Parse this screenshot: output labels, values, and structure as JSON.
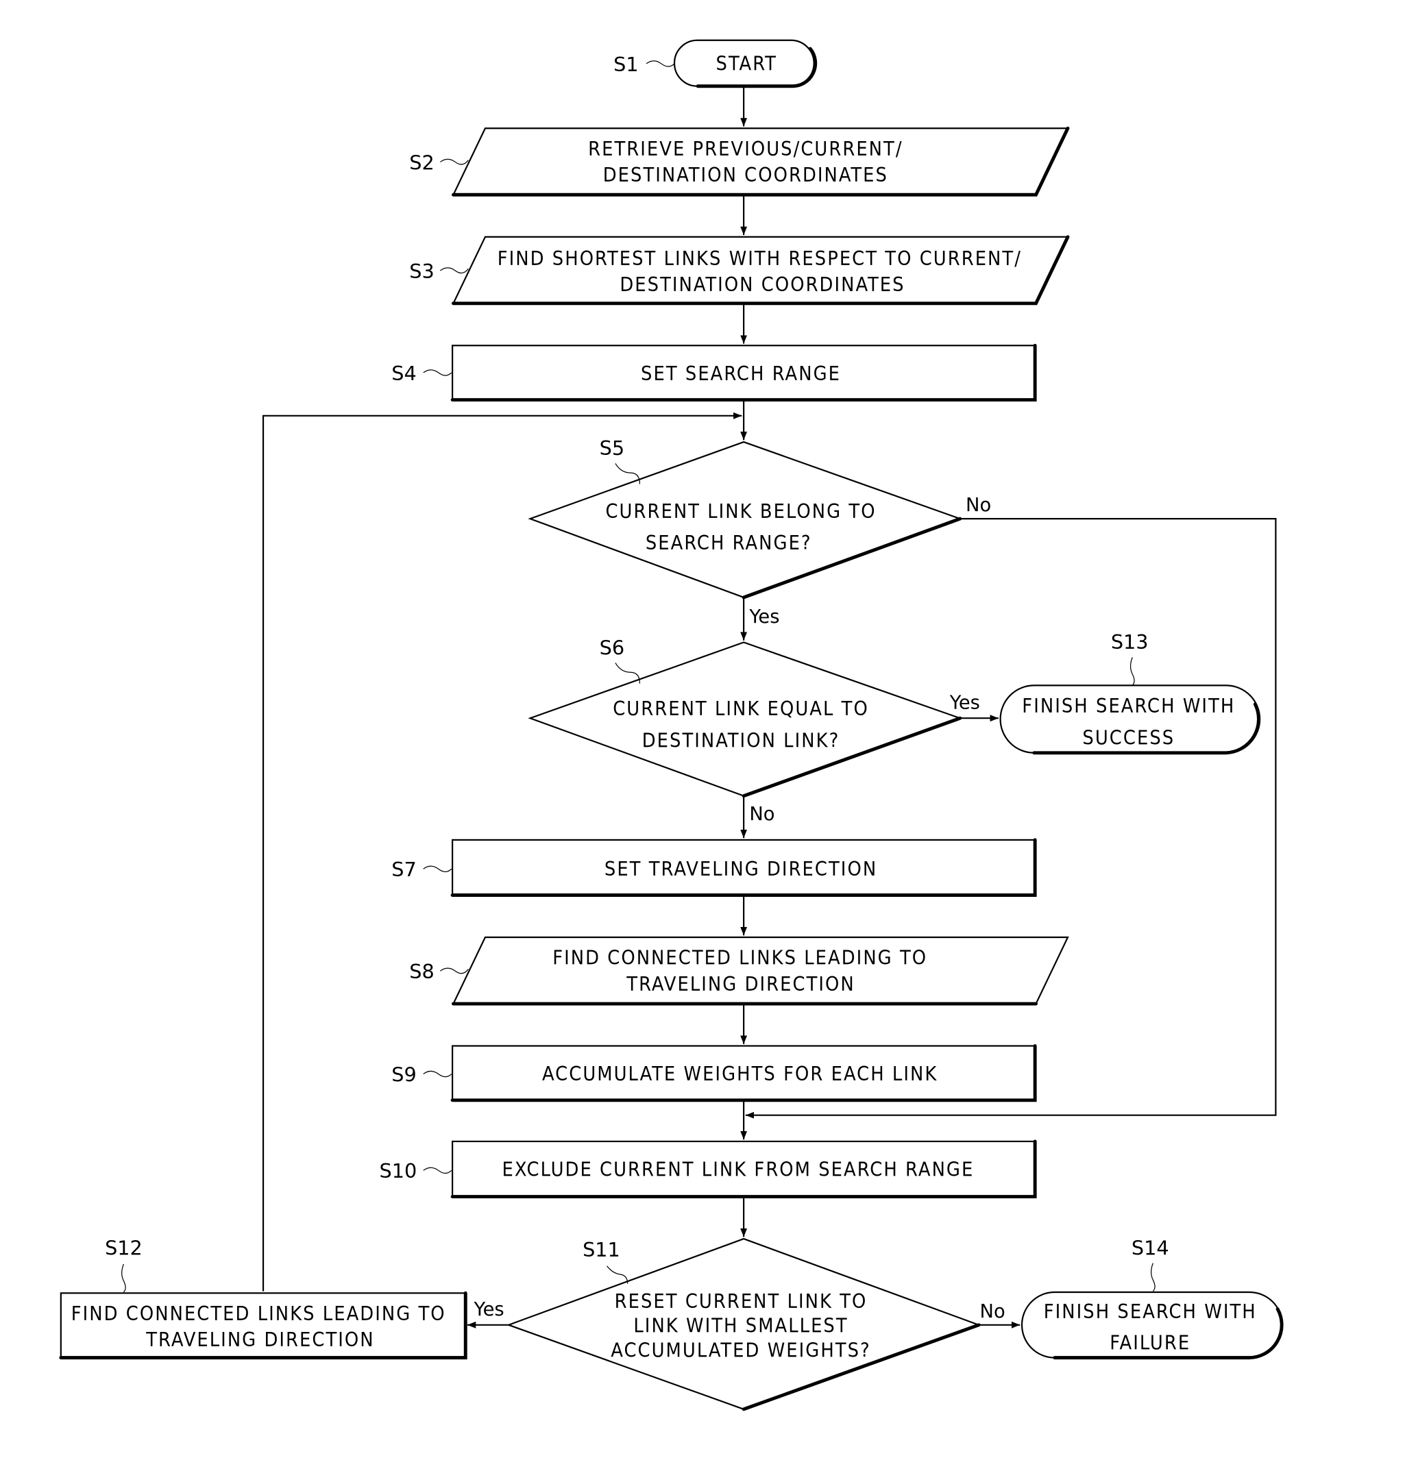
{
  "flowchart": {
    "steps": {
      "S1": {
        "label": "S1",
        "lines": [
          "START"
        ]
      },
      "S2": {
        "label": "S2",
        "lines": [
          "RETRIEVE PREVIOUS/CURRENT/",
          "DESTINATION COORDINATES"
        ]
      },
      "S3": {
        "label": "S3",
        "lines": [
          "FIND SHORTEST LINKS WITH RESPECT TO CURRENT/",
          "DESTINATION COORDINATES"
        ]
      },
      "S4": {
        "label": "S4",
        "lines": [
          "SET SEARCH RANGE"
        ]
      },
      "S5": {
        "label": "S5",
        "lines": [
          "CURRENT LINK BELONG TO",
          "SEARCH RANGE?"
        ]
      },
      "S6": {
        "label": "S6",
        "lines": [
          "CURRENT LINK EQUAL TO",
          "DESTINATION LINK?"
        ]
      },
      "S7": {
        "label": "S7",
        "lines": [
          "SET TRAVELING DIRECTION"
        ]
      },
      "S8": {
        "label": "S8",
        "lines": [
          "FIND CONNECTED LINKS LEADING TO",
          "TRAVELING DIRECTION"
        ]
      },
      "S9": {
        "label": "S9",
        "lines": [
          "ACCUMULATE WEIGHTS FOR EACH LINK"
        ]
      },
      "S10": {
        "label": "S10",
        "lines": [
          "EXCLUDE CURRENT LINK FROM SEARCH RANGE"
        ]
      },
      "S11": {
        "label": "S11",
        "lines": [
          "RESET CURRENT LINK TO",
          "LINK WITH SMALLEST",
          "ACCUMULATED WEIGHTS?"
        ]
      },
      "S12": {
        "label": "S12",
        "lines": [
          "FIND CONNECTED LINKS LEADING TO",
          "TRAVELING DIRECTION"
        ]
      },
      "S13": {
        "label": "S13",
        "lines": [
          "FINISH SEARCH WITH",
          "SUCCESS"
        ]
      },
      "S14": {
        "label": "S14",
        "lines": [
          "FINISH SEARCH WITH",
          "FAILURE"
        ]
      }
    },
    "branches": {
      "s5_no": "No",
      "s5_yes": "Yes",
      "s6_yes": "Yes",
      "s6_no": "No",
      "s11_yes": "Yes",
      "s11_no": "No"
    }
  }
}
